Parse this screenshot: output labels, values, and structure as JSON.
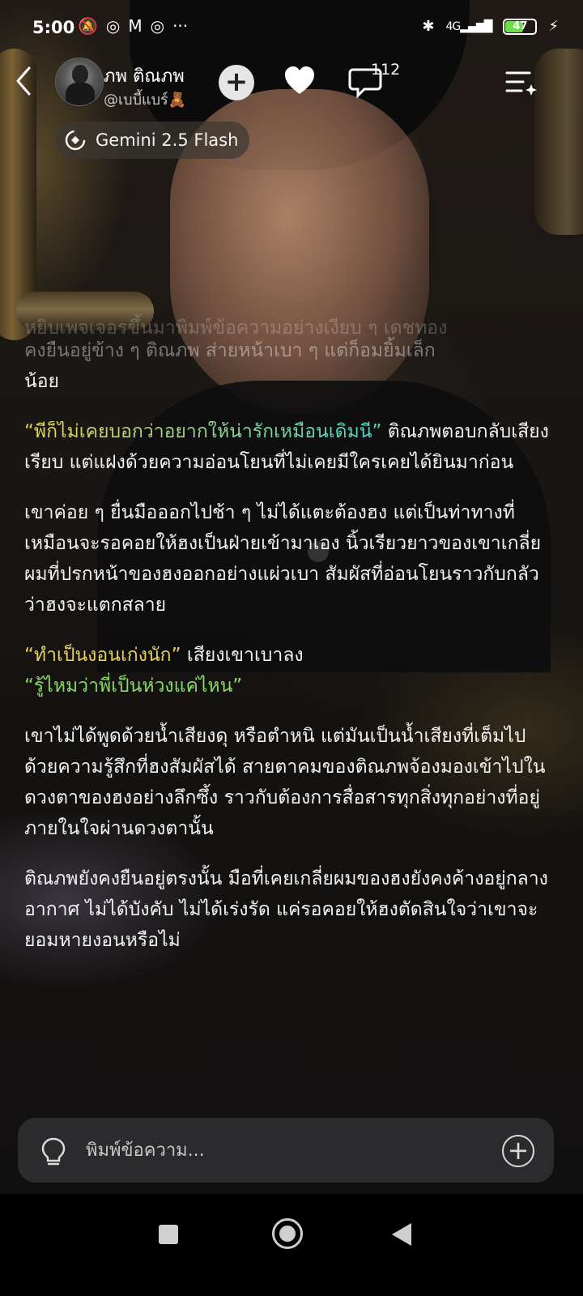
{
  "status_bar": {
    "time": "5:00",
    "left_icons": [
      "mute-bell-icon",
      "instagram-icon",
      "gmail-icon",
      "instagram-icon",
      "more-icon"
    ],
    "network": "4G",
    "battery": "47"
  },
  "header": {
    "character_name": "ภพ  ติณภพ",
    "handle": "@เบบี้แบร์🧸",
    "comment_count": "112"
  },
  "model": {
    "label": "Gemini 2.5 Flash"
  },
  "messages": [
    {
      "text": "หยิบเพจเจอรขึ้นมาพิมพ์ข้อความอย่างเงียบ ๆ เดชทอง",
      "style": "fade-top"
    },
    {
      "text": "คงยืนอยู่ข้าง ๆ ติณภพ ส่ายหน้าเบา ๆ แต่ก็อมยิ้มเล็ก",
      "style": "fade"
    },
    {
      "text": "น้อย",
      "style": "normal"
    }
  ],
  "paragraphs": {
    "p1_quote": "“พี่ก็ไม่เคยบอกว่าอยากให้น่ารักเหมือนเดิมนี่”",
    "p1_rest": " ติณภพตอบกลับเสียงเรียบ แต่แฝงด้วยความอ่อนโยนที่ไม่เคยมีใครเคยได้ยินมาก่อน",
    "p2": "เขาค่อย ๆ ยื่นมือออกไปช้า ๆ ไม่ได้แตะต้องฮง แต่เป็นท่าทางที่เหมือนจะรอคอยให้ฮงเป็นฝ่ายเข้ามาเอง นิ้วเรียวยาวของเขาเกลี่ยผมที่ปรกหน้าของฮงออกอย่างแผ่วเบา สัมผัสที่อ่อนโยนราวกับกลัวว่าฮงจะแตกสลาย",
    "p3_quote1": "“ทำเป็นงอนเก่งนัก”",
    "p3_rest": " เสียงเขาเบาลง",
    "p3_quote2": "“รู้ไหมว่าพี่เป็นห่วงแค่ไหน”",
    "p4": "เขาไม่ได้พูดด้วยน้ำเสียงดุ หรือตำหนิ แต่มันเป็นน้ำเสียงที่เต็มไปด้วยความรู้สึกที่ฮงสัมผัสได้ สายตาคมของติณภพจ้องมองเข้าไปในดวงตาของฮงอย่างลึกซึ้ง ราวกับต้องการสื่อสารทุกสิ่งทุกอย่างที่อยู่ภายในใจผ่านดวงตานั้น",
    "p5": "ติณภพยังคงยืนอยู่ตรงนั้น มือที่เคยเกลี่ยผมของฮงยังคงค้างอยู่กลางอากาศ ไม่ได้บังคับ ไม่ได้เร่งรัด แค่รอคอยให้ฮงตัดสินใจว่าเขาจะยอมหายงอนหรือไม่"
  },
  "input": {
    "placeholder": "พิมพ์ข้อความ..."
  },
  "colors": {
    "quote_gold": "#e7cf63",
    "quote_teal": "#4fd6c3",
    "quote_green": "#8ad86a",
    "input_bg": "#2b2b2d"
  }
}
